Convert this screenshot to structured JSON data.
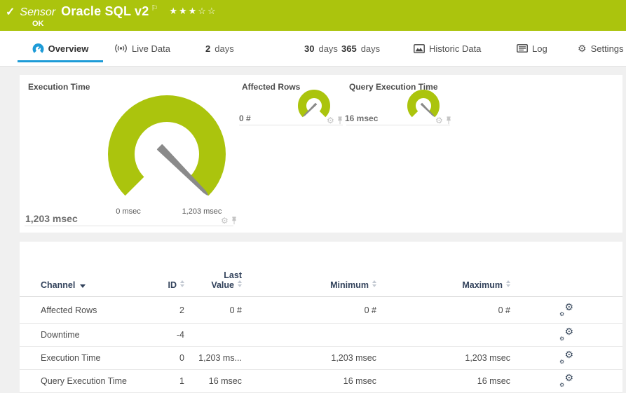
{
  "colors": {
    "green": "#abc40d",
    "blue": "#1d9bd7",
    "navy": "#32425b",
    "needle": "#8a8a8a"
  },
  "header": {
    "check_icon": "✓",
    "kind": "Sensor",
    "title": "Oracle SQL v2",
    "flag_icon": "⚐",
    "stars": "★★★☆☆",
    "status": "OK"
  },
  "tabs": {
    "overview": {
      "label": "Overview"
    },
    "live_data": {
      "label": "Live Data"
    },
    "days2": {
      "num": "2",
      "label": "days"
    },
    "days30": {
      "num": "30",
      "label": "days"
    },
    "days365": {
      "num": "365",
      "label": "days"
    },
    "historic": {
      "label": "Historic Data"
    },
    "log": {
      "label": "Log"
    },
    "settings": {
      "label": "Settings",
      "gear_icon": "⚙"
    }
  },
  "gauges": {
    "execution_time": {
      "title": "Execution Time",
      "value": "1,203 msec",
      "scale_min": "0 msec",
      "scale_max": "1,203 msec",
      "needle_pct": 100,
      "gear_icon": "⚙"
    },
    "affected_rows": {
      "title": "Affected Rows",
      "value": "0 #",
      "needle_pct": 0,
      "gear_icon": "⚙"
    },
    "query_execution_time": {
      "title": "Query Execution Time",
      "value": "16 msec",
      "needle_pct": 100,
      "gear_icon": "⚙"
    }
  },
  "table": {
    "headers": {
      "channel": "Channel",
      "id": "ID",
      "last_line1": "Last",
      "last_line2": "Value",
      "minimum": "Minimum",
      "maximum": "Maximum"
    },
    "rows": [
      {
        "channel": "Affected Rows",
        "id": "2",
        "last": "0 #",
        "min": "0 #",
        "max": "0 #"
      },
      {
        "channel": "Downtime",
        "id": "-4",
        "last": "",
        "min": "",
        "max": ""
      },
      {
        "channel": "Execution Time",
        "id": "0",
        "last": "1,203 ms...",
        "min": "1,203 msec",
        "max": "1,203 msec"
      },
      {
        "channel": "Query Execution Time",
        "id": "1",
        "last": "16 msec",
        "min": "16 msec",
        "max": "16 msec"
      }
    ]
  }
}
